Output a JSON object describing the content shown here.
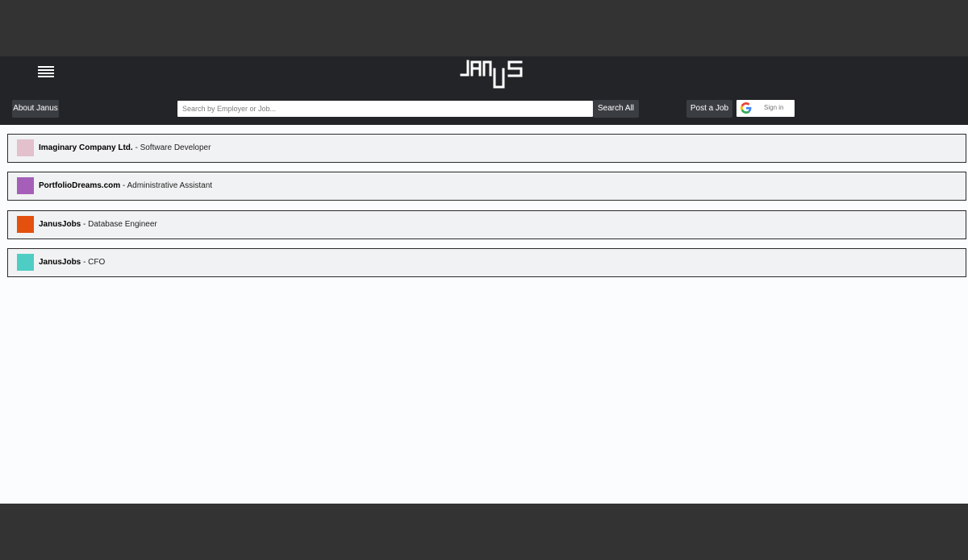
{
  "header": {
    "logo_text": "JANUS",
    "about_label": "About Janus",
    "search_placeholder": "Search by Employer or Job...",
    "search_value": "",
    "search_all_label": "Search All",
    "post_job_label": "Post a Job",
    "sign_in_label": "Sign in"
  },
  "jobs": [
    {
      "employer": "Imaginary Company Ltd.",
      "separator": " - ",
      "title": "Software Developer",
      "color": "#e2c0cc"
    },
    {
      "employer": "PortfolioDreams.com",
      "separator": " - ",
      "title": "Administrative Assistant",
      "color": "#a55fb9"
    },
    {
      "employer": "JanusJobs",
      "separator": " - ",
      "title": "Database Engineer",
      "color": "#e4500e"
    },
    {
      "employer": "JanusJobs",
      "separator": " - ",
      "title": "CFO",
      "color": "#4ecdc4"
    }
  ]
}
